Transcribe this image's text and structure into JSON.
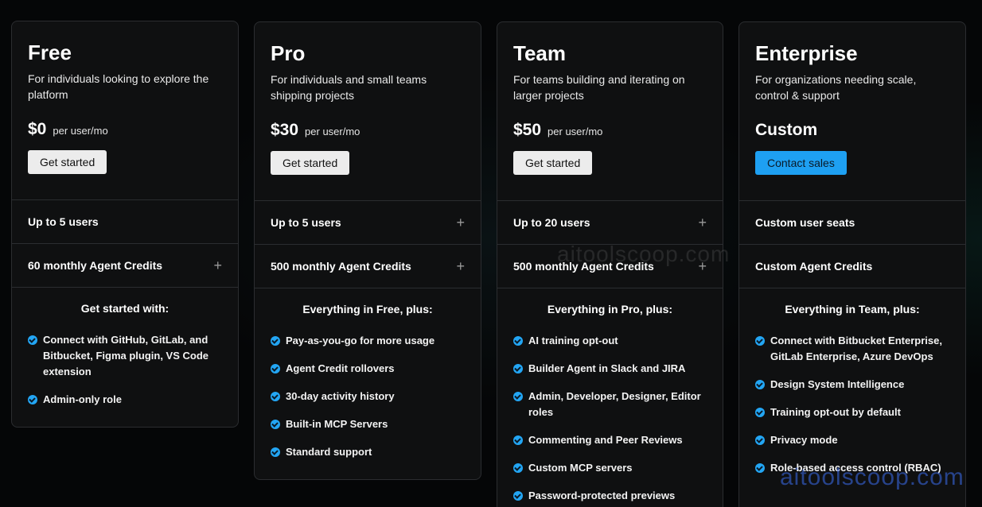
{
  "watermarks": [
    "aitoolscoop.com",
    "aitoolscoop.com"
  ],
  "plans": [
    {
      "name": "Free",
      "desc": "For individuals looking to explore the platform",
      "price": "$0",
      "per": "per user/mo",
      "cta": "Get started",
      "users": "Up to 5 users",
      "credits": "60 monthly Agent Credits",
      "features_title": "Get started with:",
      "features": [
        "Connect with GitHub, GitLab, and Bitbucket, Figma plugin, VS Code extension",
        "Admin-only role"
      ]
    },
    {
      "name": "Pro",
      "desc": "For individuals and small teams shipping projects",
      "price": "$30",
      "per": "per user/mo",
      "cta": "Get started",
      "users": "Up to 5 users",
      "credits": "500 monthly Agent Credits",
      "features_title": "Everything in Free, plus:",
      "features": [
        "Pay-as-you-go for more usage",
        "Agent Credit rollovers",
        "30-day activity history",
        "Built-in MCP Servers",
        "Standard support"
      ]
    },
    {
      "name": "Team",
      "desc": "For teams building and iterating on larger projects",
      "price": "$50",
      "per": "per user/mo",
      "cta": "Get started",
      "users": "Up to 20 users",
      "credits": "500 monthly Agent Credits",
      "features_title": "Everything in Pro, plus:",
      "features": [
        "AI training opt-out",
        "Builder Agent in Slack and JIRA",
        "Admin, Developer, Designer, Editor roles",
        "Commenting and Peer Reviews",
        "Custom MCP servers",
        "Password-protected previews"
      ]
    },
    {
      "name": "Enterprise",
      "desc": "For organizations needing scale, control & support",
      "price": "Custom",
      "per": "",
      "cta": "Contact sales",
      "users": "Custom user seats",
      "credits": "Custom Agent Credits",
      "features_title": "Everything in Team, plus:",
      "features": [
        "Connect with Bitbucket Enterprise, GitLab Enterprise, Azure DevOps",
        "Design System Intelligence",
        "Training opt-out by default",
        "Privacy mode",
        "Role-based access control (RBAC)"
      ]
    }
  ],
  "colors": {
    "accent": "#1ea0f2",
    "card_bg": "#0f1011",
    "border": "#2b2d30"
  },
  "icons": {
    "check": "check-circle-icon",
    "expand": "plus-icon"
  }
}
